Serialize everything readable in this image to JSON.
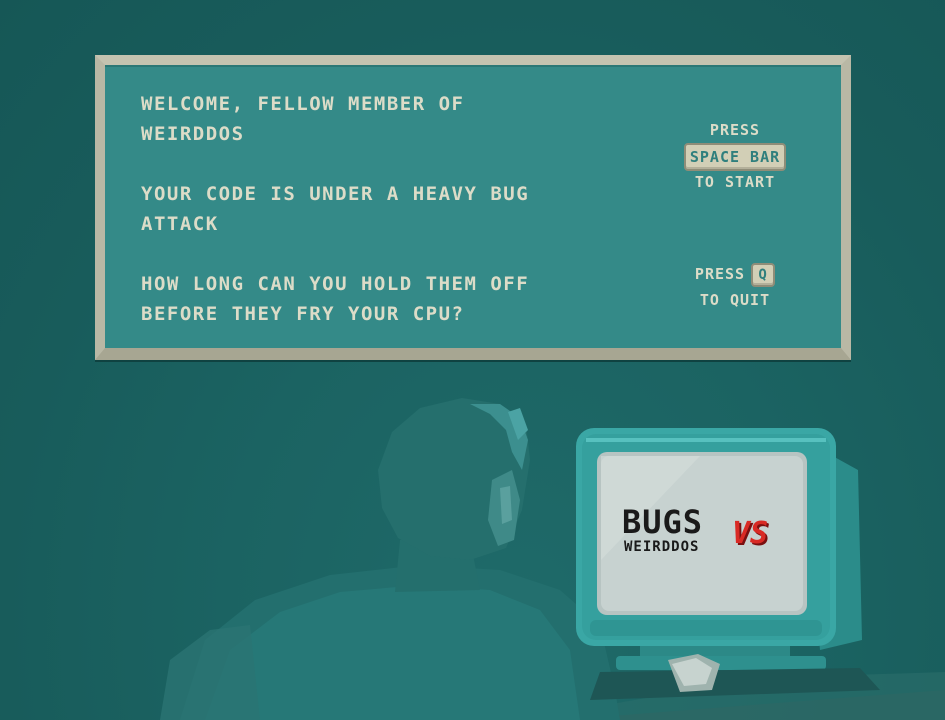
{
  "intro": {
    "lines": [
      "WELCOME, FELLOW MEMBER OF WEIRDDOS",
      "YOUR CODE IS UNDER A HEAVY BUG ATTACK",
      "HOW LONG CAN YOU HOLD THEM OFF BEFORE THEY FRY YOUR CPU?"
    ]
  },
  "controls": {
    "start": {
      "press": "PRESS",
      "key": "SPACE BAR",
      "action": "TO START"
    },
    "quit": {
      "press": "PRESS",
      "key": "Q",
      "action": "TO QUIT"
    }
  },
  "logo": {
    "bugs": "BUGS",
    "vs": "VS",
    "weirddos": "WEIRDDOS"
  },
  "colors": {
    "background": "#1b6362",
    "panel": "#348a88",
    "panel_border": "#b9b8a5",
    "panel_text": "#dcdcc8",
    "key_cap": "#d2cfb6",
    "monitor": "#3aa7a5",
    "logo_red": "#d92a24"
  }
}
